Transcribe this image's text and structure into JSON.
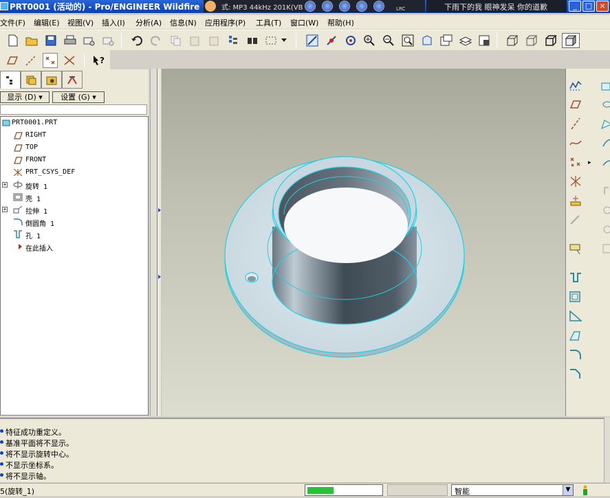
{
  "window": {
    "title": "PRT0001 (活动的) - Pro/ENGINEER Wildfire"
  },
  "media_player": {
    "info": "式: MP3 44kHz 201K(VB",
    "lrc_label": "LRC",
    "song": "下雨下的我 眼神发呆 你的道歉"
  },
  "window_buttons": {
    "minimize": "_",
    "maximize": "□",
    "close": "×"
  },
  "menu": {
    "items": [
      "文件(F)",
      "编辑(E)",
      "视图(V)",
      "插入(I)",
      "分析(A)",
      "信息(N)",
      "应用程序(P)",
      "工具(T)",
      "窗口(W)",
      "帮助(H)"
    ]
  },
  "model_tree": {
    "show_label": "显示 (D) ▾",
    "settings_label": "设置 (G) ▾",
    "items": [
      {
        "label": "PRT0001.PRT",
        "icon": "part-icon"
      },
      {
        "label": "RIGHT",
        "icon": "datum-plane-icon"
      },
      {
        "label": "TOP",
        "icon": "datum-plane-icon"
      },
      {
        "label": "FRONT",
        "icon": "datum-plane-icon"
      },
      {
        "label": "PRT_CSYS_DEF",
        "icon": "coordinate-system-icon"
      },
      {
        "label": "旋转 1",
        "icon": "revolve-icon",
        "expandable": true
      },
      {
        "label": "壳 1",
        "icon": "shell-icon"
      },
      {
        "label": "拉伸 1",
        "icon": "extrude-icon",
        "expandable": true
      },
      {
        "label": "倒圆角 1",
        "icon": "round-icon"
      },
      {
        "label": "孔 1",
        "icon": "hole-icon"
      },
      {
        "label": "在此插入",
        "icon": "insert-here-arrow-icon"
      }
    ]
  },
  "messages": [
    "特征成功重定义。",
    "基准平面将不显示。",
    "将不显示旋转中心。",
    "不显示坐标系。",
    "将不显示轴。"
  ],
  "status": {
    "left_text": "5(旋转_1)",
    "progress": 0.35,
    "filter_value": "智能"
  },
  "colors": {
    "model_edge": "#19d3e6",
    "model_body": "#cfdde6",
    "viewport_top": "#a8a89a",
    "progress": "#27c23a",
    "title_bar": "#0a3fb0"
  }
}
